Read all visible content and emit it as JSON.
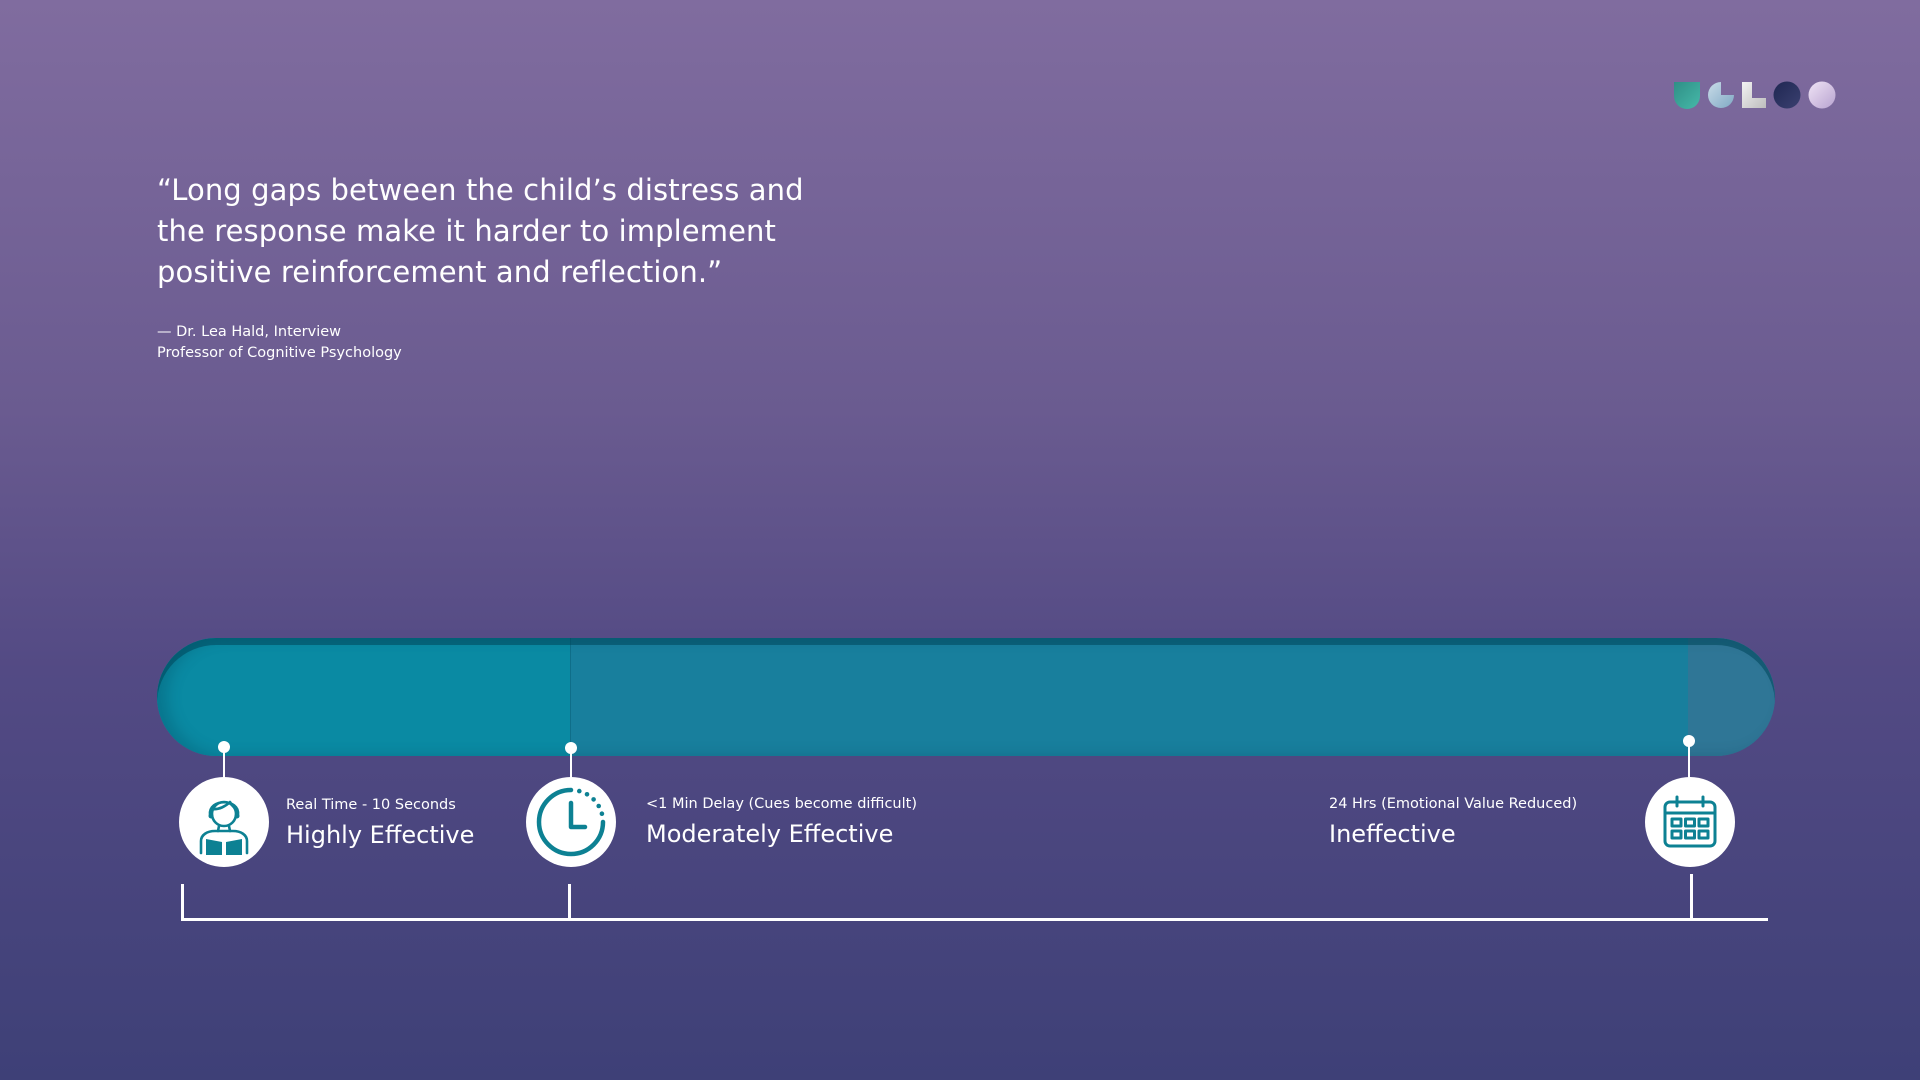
{
  "quote": {
    "text": "“Long gaps between the child’s distress and the response make it harder to implement positive reinforcement and reflection.”",
    "attribution": "— Dr. Lea Hald, Interview",
    "role": "Professor of Cognitive Psychology"
  },
  "timeline": {
    "stages": [
      {
        "caption": "Real Time - 10 Seconds",
        "rating": "Highly Effective",
        "icon": "child-icon"
      },
      {
        "caption": "<1 Min Delay (Cues become difficult)",
        "rating": "Moderately Effective",
        "icon": "clock-icon"
      },
      {
        "caption": "24 Hrs (Emotional Value Reduced)",
        "rating": "Ineffective",
        "icon": "calendar-icon"
      }
    ],
    "colors": {
      "segment_real_time": "#0a8aa3",
      "segment_delay": "#187f9d",
      "segment_end": "#2f7696",
      "icon": "#0d8193"
    }
  },
  "logo": {
    "colors": [
      "#3aa59a",
      "#9fc3d8",
      "#e6e6e6",
      "#27305e",
      "#d9c8e8"
    ]
  }
}
